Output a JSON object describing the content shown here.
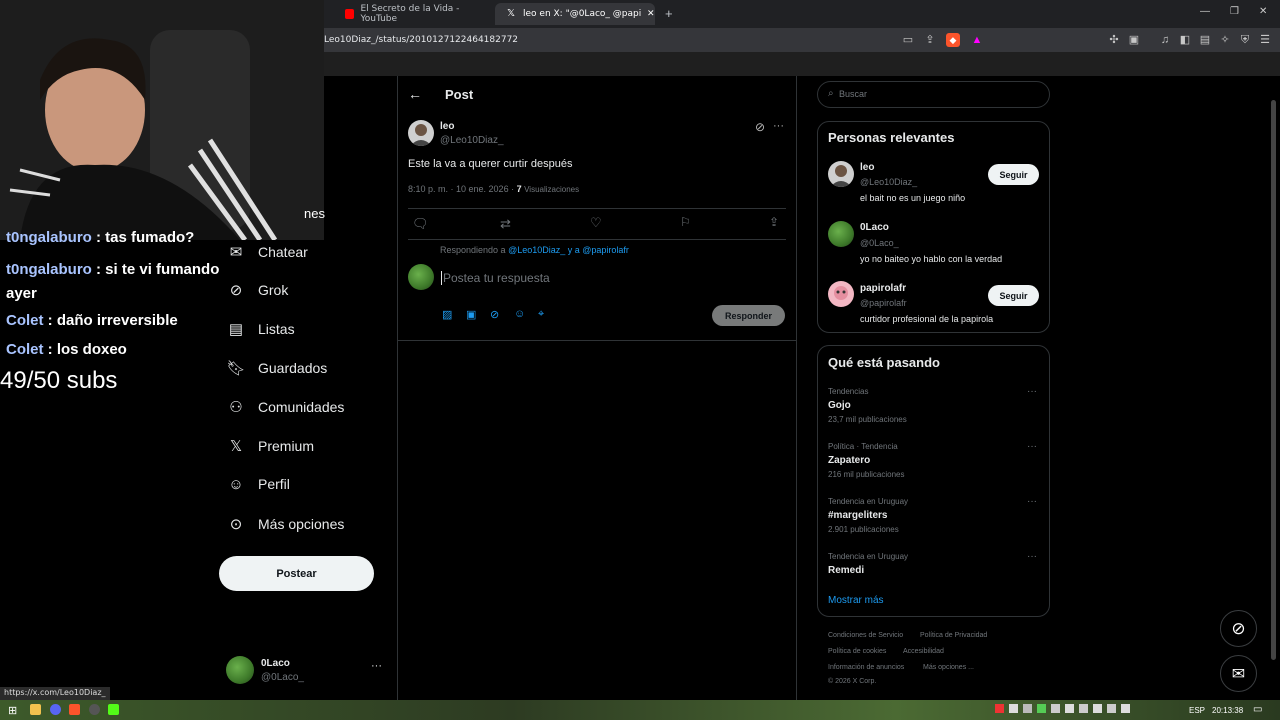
{
  "browser": {
    "tabs": [
      {
        "label": "El Secreto de la Vida - YouTube"
      },
      {
        "label": "leo en X: \"@0Laco_ @papirolafr"
      }
    ],
    "url": "Leo10Diaz_/status/2010127122464182772",
    "status_url": "https://x.com/Leo10Diaz_"
  },
  "overlay": {
    "chat": [
      {
        "user": "t0ngalaburo",
        "msg": " : tas fumado?"
      },
      {
        "user": "t0ngalaburo",
        "msg": " : si te vi fumando ayer"
      },
      {
        "user": "Colet",
        "msg": " : daño irreversible"
      },
      {
        "user": "Colet",
        "msg": " : los doxeo"
      }
    ],
    "subs": "49/50 subs",
    "cut_text": "nes"
  },
  "sidebar": {
    "items": [
      {
        "label": "Chatear",
        "icon": "mail-icon"
      },
      {
        "label": "Grok",
        "icon": "grok-icon"
      },
      {
        "label": "Listas",
        "icon": "list-icon"
      },
      {
        "label": "Guardados",
        "icon": "bookmark-icon"
      },
      {
        "label": "Comunidades",
        "icon": "communities-icon"
      },
      {
        "label": "Premium",
        "icon": "x-icon"
      },
      {
        "label": "Perfil",
        "icon": "person-icon"
      },
      {
        "label": "Más opciones",
        "icon": "more-icon"
      }
    ],
    "post_button": "Postear",
    "account": {
      "name": "0Laco",
      "handle": "@0Laco_"
    }
  },
  "post": {
    "header": "Post",
    "author": {
      "name": "leo",
      "handle": "@Leo10Diaz_"
    },
    "text": "Este la va a querer curtir después",
    "meta": "8:10 p. m. · 10 ene. 2026 · ",
    "views_count": "7",
    "views_label": "Visualizaciones",
    "replying_prefix": "Respondiendo a ",
    "replying_to": "@Leo10Diaz_ y a @papirolafr",
    "reply_placeholder": "Postea tu respuesta",
    "reply_button": "Responder"
  },
  "right": {
    "search_placeholder": "Buscar",
    "relevant_title": "Personas relevantes",
    "people": [
      {
        "name": "leo",
        "handle": "@Leo10Diaz_",
        "bio": "el bait no es un juego niño",
        "button": "Seguir"
      },
      {
        "name": "0Laco",
        "handle": "@0Laco_",
        "bio": "yo no baiteo yo hablo con la verdad",
        "button": ""
      },
      {
        "name": "papirolafr",
        "handle": "@papirolafr",
        "bio": "curtidor profesional de la papirola",
        "button": "Seguir"
      }
    ],
    "trending_title": "Qué está pasando",
    "trends": [
      {
        "context": "Tendencias",
        "name": "Gojo",
        "count": "23,7 mil publicaciones"
      },
      {
        "context": "Política · Tendencia",
        "name": "Zapatero",
        "count": "216 mil publicaciones"
      },
      {
        "context": "Tendencia en Uruguay",
        "name": "#margeliters",
        "count": "2.901 publicaciones"
      },
      {
        "context": "Tendencia en Uruguay",
        "name": "Remedi",
        "count": ""
      }
    ],
    "show_more": "Mostrar más",
    "footer": [
      "Condiciones de Servicio",
      "Política de Privacidad",
      "Política de cookies",
      "Accesibilidad",
      "Información de anuncios",
      "Más opciones ...",
      "© 2026 X Corp."
    ]
  },
  "taskbar": {
    "lang": "ESP",
    "time": "20:13:38"
  }
}
